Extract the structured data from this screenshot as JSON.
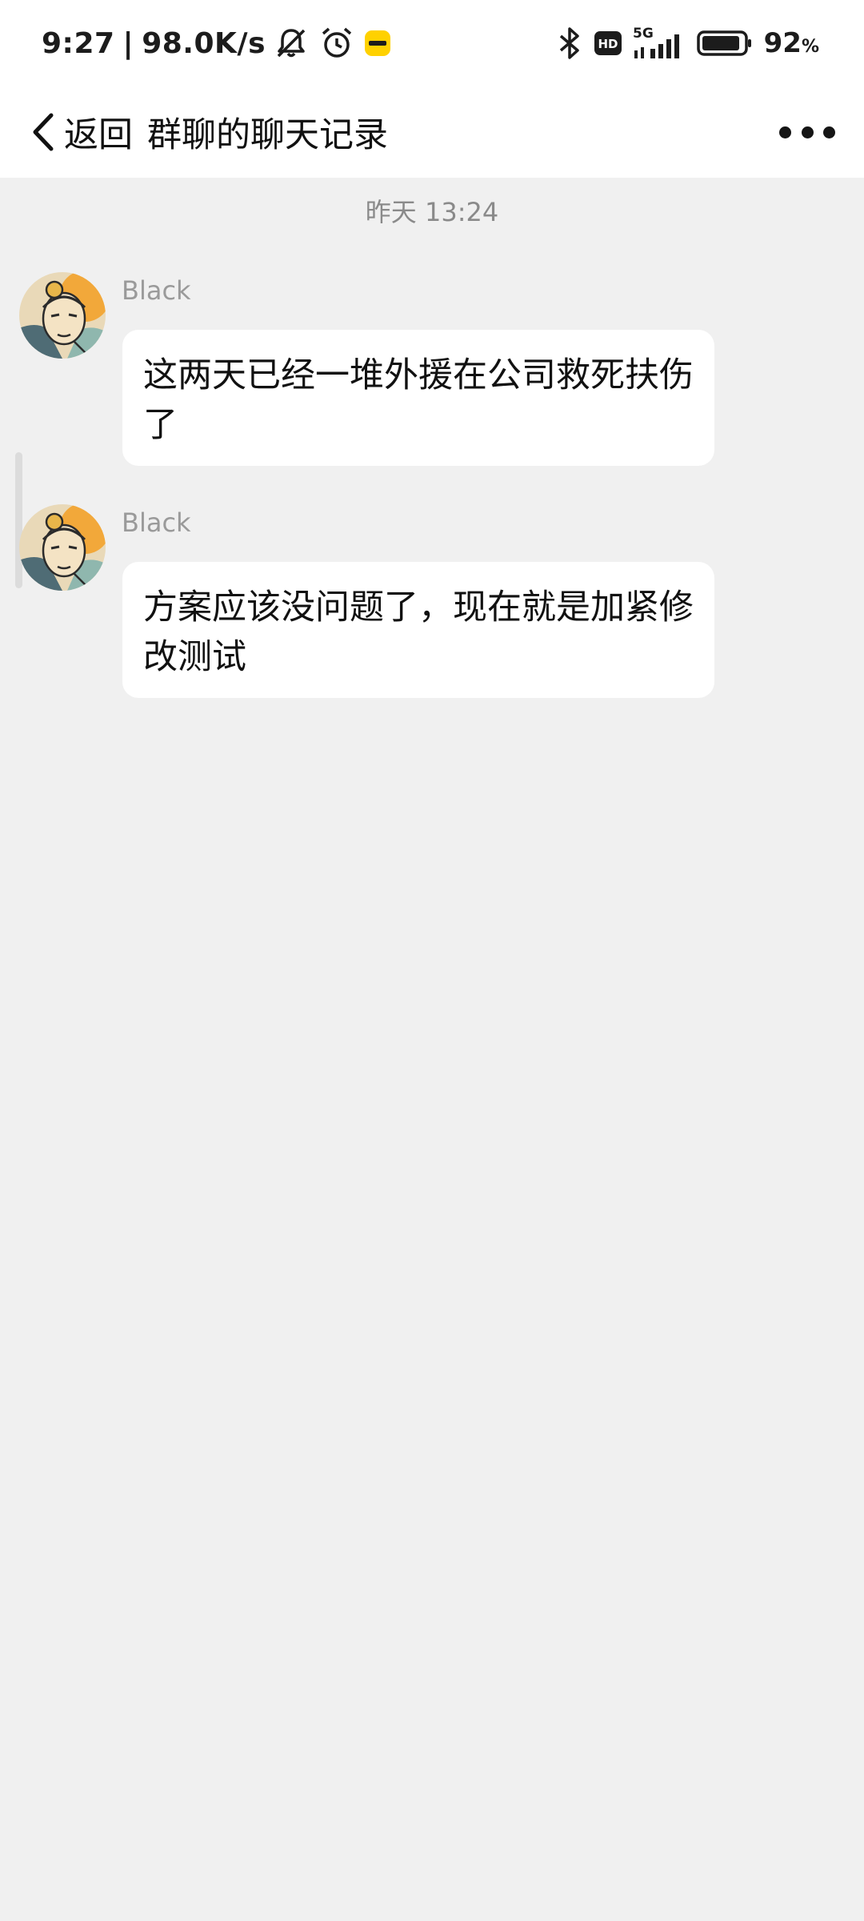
{
  "status_bar": {
    "time": "9:27",
    "network_speed": "98.0K/s",
    "network_type": "5G",
    "hd_label": "HD",
    "app_badge": "美团",
    "battery_percent": "92",
    "battery_unit": "%",
    "battery_level": 0.92,
    "icons": [
      "mute-bell-icon",
      "alarm-clock-icon",
      "meituan-app-icon",
      "bluetooth-icon",
      "hd-icon",
      "signal-icon",
      "battery-icon"
    ]
  },
  "nav": {
    "back_label": "返回",
    "title": "群聊的聊天记录",
    "more_icon": "more-dots-icon"
  },
  "chat": {
    "timestamp": "昨天 13:24",
    "messages": [
      {
        "sender": "Black",
        "text": "这两天已经一堆外援在公司救死扶伤了"
      },
      {
        "sender": "Black",
        "text": "方案应该没问题了，现在就是加紧修改测试"
      }
    ]
  },
  "colors": {
    "background": "#f0f0f0",
    "header": "#ffffff",
    "bubble": "#ffffff",
    "secondary_text": "#8a8a8a",
    "meituan_yellow": "#ffd100"
  }
}
